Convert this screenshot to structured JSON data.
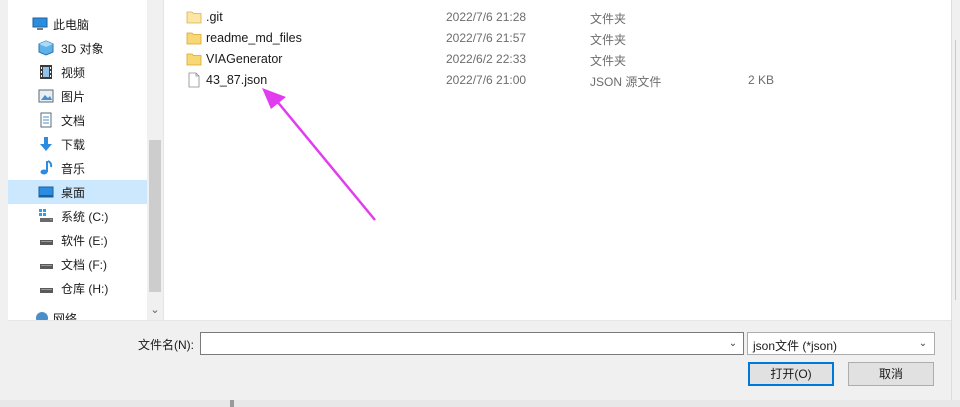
{
  "nav": {
    "items": [
      {
        "label": "此电脑",
        "icon": "computer-icon"
      },
      {
        "label": "3D 对象",
        "icon": "3d-objects-icon"
      },
      {
        "label": "视频",
        "icon": "video-icon"
      },
      {
        "label": "图片",
        "icon": "pictures-icon"
      },
      {
        "label": "文档",
        "icon": "documents-icon"
      },
      {
        "label": "下载",
        "icon": "download-icon"
      },
      {
        "label": "音乐",
        "icon": "music-icon"
      },
      {
        "label": "桌面",
        "icon": "desktop-icon",
        "selected": true
      },
      {
        "label": "系统 (C:)",
        "icon": "system-drive-icon"
      },
      {
        "label": "软件 (E:)",
        "icon": "drive-icon"
      },
      {
        "label": "文档 (F:)",
        "icon": "drive-icon"
      },
      {
        "label": "仓库 (H:)",
        "icon": "drive-icon"
      },
      {
        "label": "网络",
        "icon": "network-icon"
      }
    ]
  },
  "files": [
    {
      "name": ".git",
      "date": "2022/7/6 21:28",
      "type": "文件夹",
      "size": "",
      "icon": "folder-icon"
    },
    {
      "name": "readme_md_files",
      "date": "2022/7/6 21:57",
      "type": "文件夹",
      "size": "",
      "icon": "folder-icon"
    },
    {
      "name": "VIAGenerator",
      "date": "2022/6/2 22:33",
      "type": "文件夹",
      "size": "",
      "icon": "folder-icon"
    },
    {
      "name": "43_87.json",
      "date": "2022/7/6 21:00",
      "type": "JSON 源文件",
      "size": "2 KB",
      "icon": "json-file-icon"
    }
  ],
  "bottom": {
    "filename_label": "文件名(N):",
    "filename_value": "",
    "filter_value": "json文件 (*json)",
    "open_label": "打开(O)",
    "cancel_label": "取消"
  },
  "colors": {
    "selection": "#cce8ff",
    "arrow": "#e23cf0",
    "folder": "#f8d775",
    "primary_border": "#0078d7"
  }
}
